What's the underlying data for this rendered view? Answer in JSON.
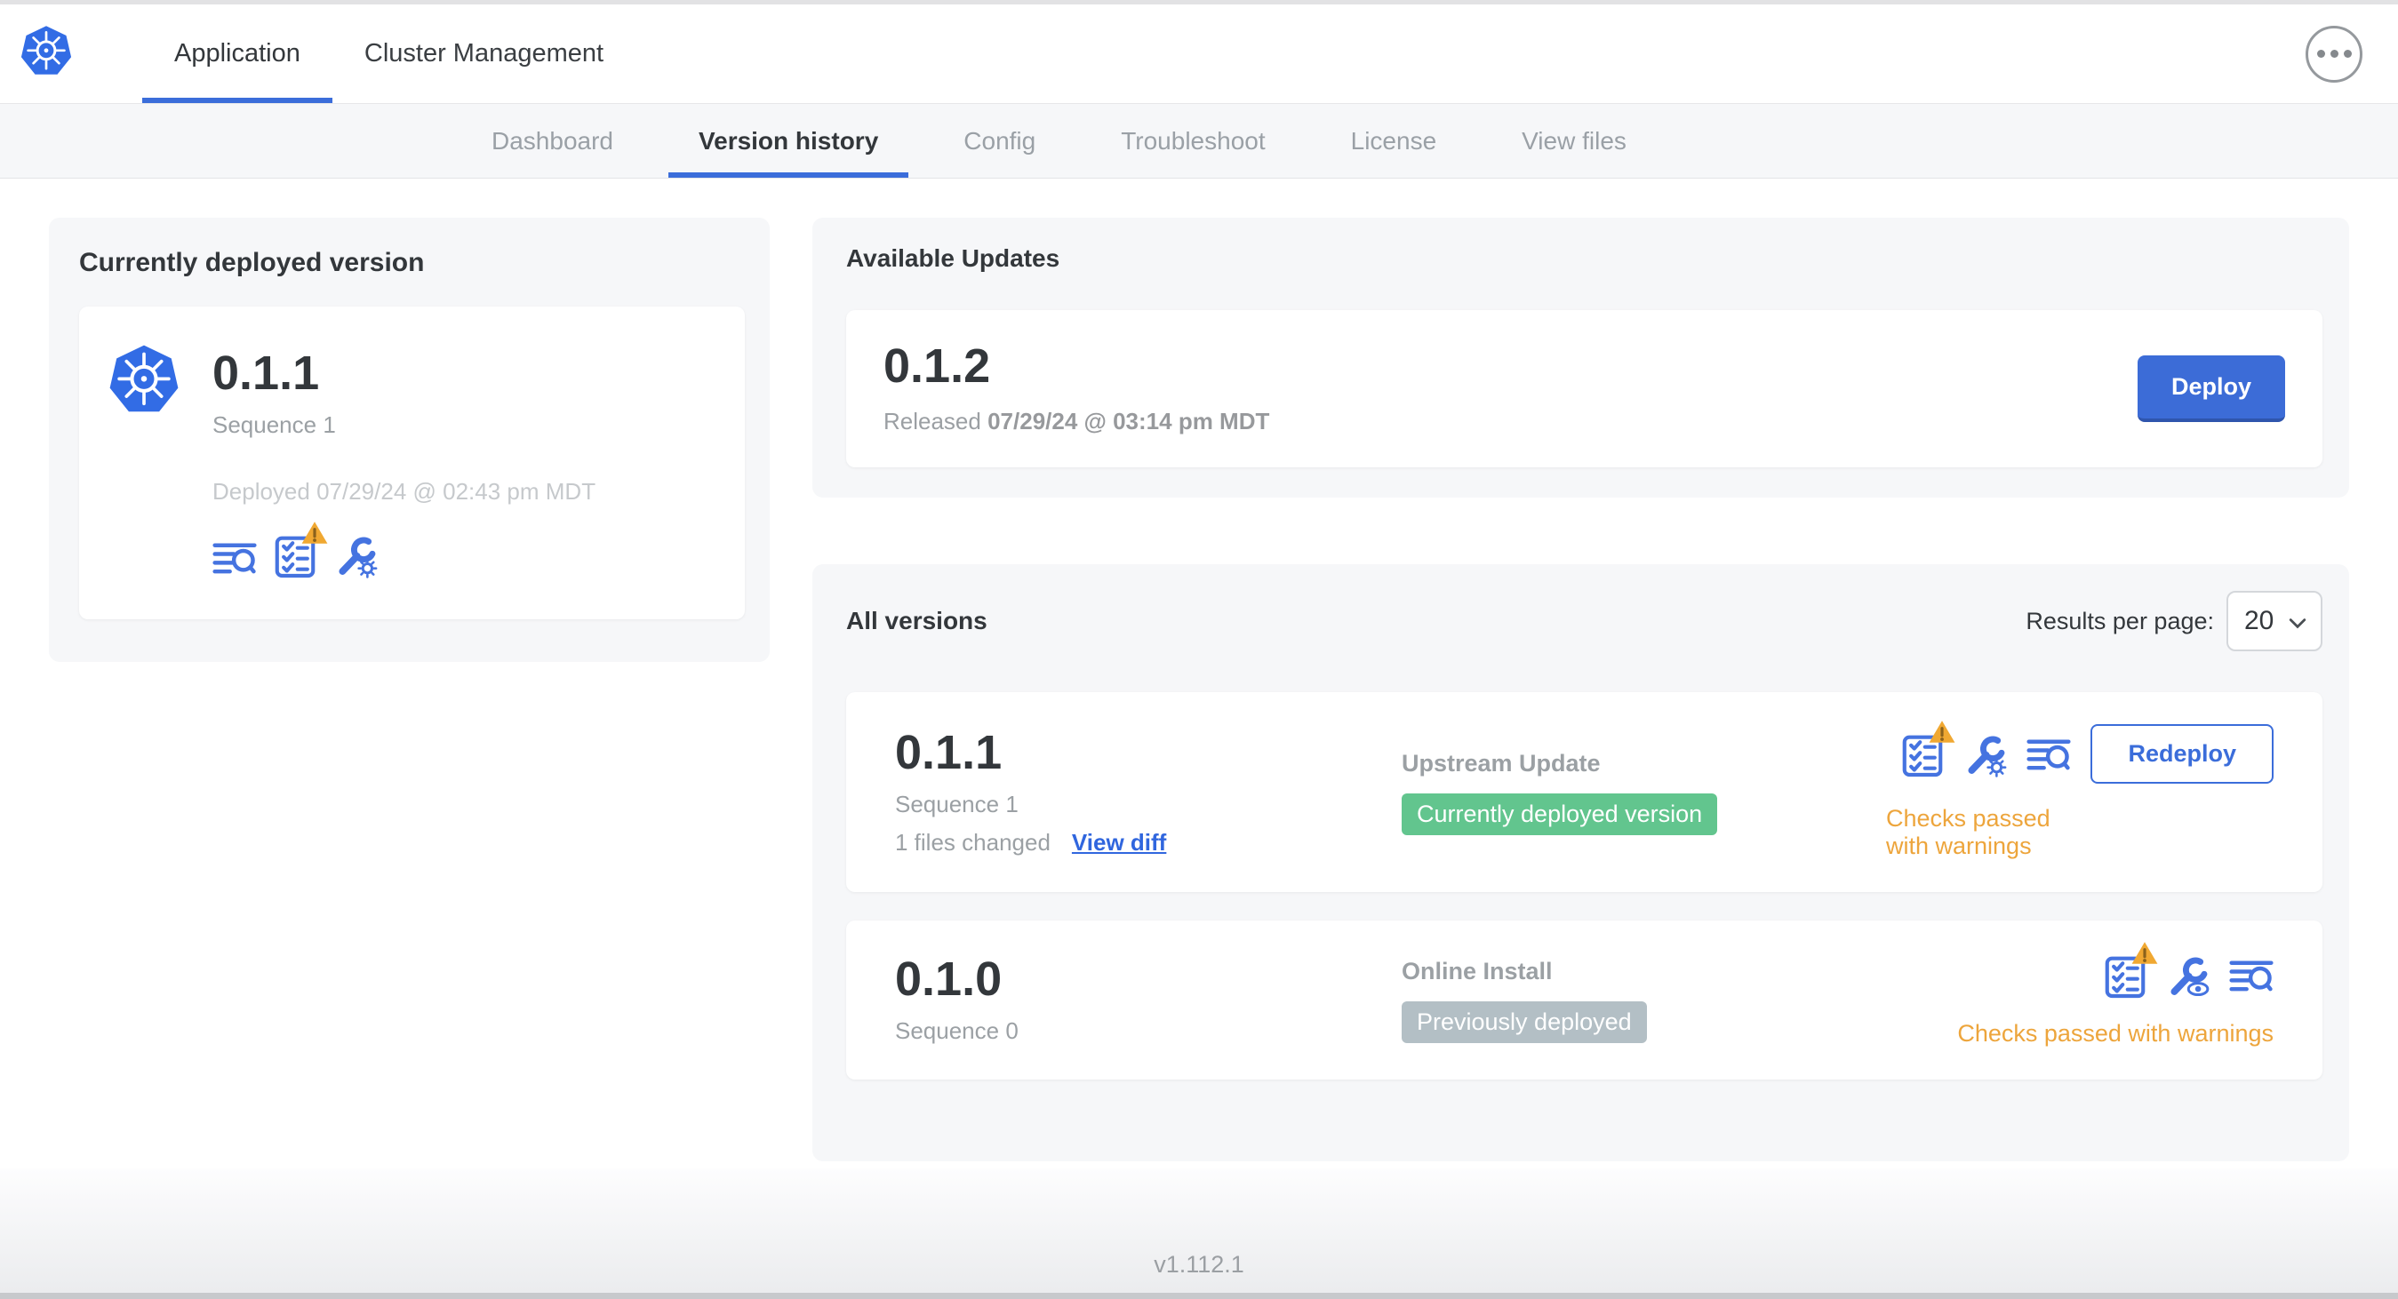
{
  "header": {
    "logo_icon": "kubernetes-logo",
    "tabs": [
      {
        "label": "Application",
        "active": true
      },
      {
        "label": "Cluster Management",
        "active": false
      }
    ],
    "menu_icon": "ellipsis-menu"
  },
  "subnav": {
    "tabs": [
      {
        "label": "Dashboard",
        "active": false
      },
      {
        "label": "Version history",
        "active": true
      },
      {
        "label": "Config",
        "active": false
      },
      {
        "label": "Troubleshoot",
        "active": false
      },
      {
        "label": "License",
        "active": false
      },
      {
        "label": "View files",
        "active": false
      }
    ]
  },
  "current_version": {
    "section_title": "Currently deployed version",
    "version": "0.1.1",
    "sequence": "Sequence 1",
    "deployed": "Deployed 07/29/24 @ 02:43 pm MDT",
    "icons": [
      "logs-icon",
      "preflight-checks-icon with warning-triangle",
      "config-edit-icon"
    ]
  },
  "available_updates": {
    "section_title": "Available Updates",
    "version": "0.1.2",
    "released_prefix": "Released",
    "released_date": "07/29/24 @ 03:14 pm MDT",
    "deploy_label": "Deploy"
  },
  "all_versions": {
    "section_title": "All versions",
    "results_per_page_label": "Results per page:",
    "results_per_page_value": "20",
    "rows": [
      {
        "version": "0.1.1",
        "sequence": "Sequence 1",
        "files_changed": "1 files changed",
        "view_diff_label": "View diff",
        "source": "Upstream Update",
        "badge_label": "Currently deployed version",
        "badge_color": "#62c58e",
        "icons": [
          "preflight-checks-icon with warning-triangle",
          "config-edit-icon",
          "logs-icon"
        ],
        "action_label": "Redeploy",
        "status": "Checks passed with warnings"
      },
      {
        "version": "0.1.0",
        "sequence": "Sequence 0",
        "source": "Online Install",
        "badge_label": "Previously deployed",
        "badge_color": "#b3bfc5",
        "icons": [
          "preflight-checks-icon with warning-triangle",
          "config-view-icon",
          "logs-icon"
        ],
        "status": "Checks passed with warnings"
      }
    ]
  },
  "footer": {
    "app_version": "v1.112.1"
  },
  "colors": {
    "accent_blue": "#3b6dda",
    "link_blue": "#3066de",
    "kubernetes_blue": "#326ce5",
    "deploy_button": "#3c6cd7",
    "green_badge": "#62c58e",
    "gray_badge": "#b3bfc5",
    "warning_orange": "#eda53c",
    "panel_gray": "#f6f7f9",
    "subnav_gray": "#f6f7f9"
  }
}
